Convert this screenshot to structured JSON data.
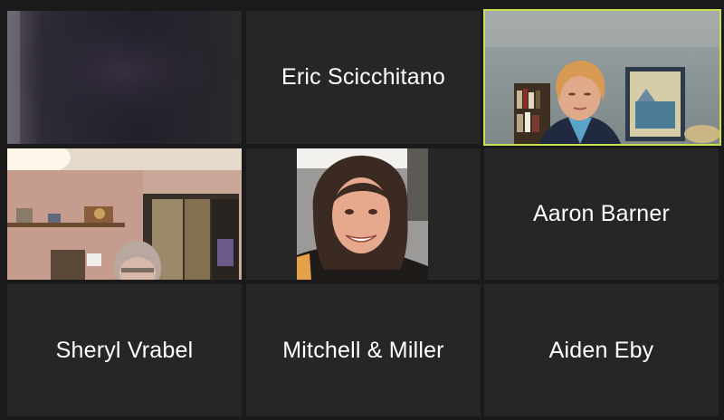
{
  "app": {
    "type": "video-call-gallery-view"
  },
  "colors": {
    "tile_bg": "#262626",
    "gap_bg": "#1a1a1a",
    "active_speaker_border": "#c8e04f",
    "name_text": "#ffffff"
  },
  "participants": [
    {
      "name": "",
      "video": "dark-blurry-camera"
    },
    {
      "name": "Eric Scicchitano",
      "video": "off"
    },
    {
      "name": "",
      "video": "on",
      "active_speaker": true
    },
    {
      "name": "",
      "video": "on"
    },
    {
      "name": "",
      "video": "on"
    },
    {
      "name": "Aaron Barner",
      "video": "off"
    },
    {
      "name": "Sheryl Vrabel",
      "video": "off"
    },
    {
      "name": "Mitchell & Miller",
      "video": "off"
    },
    {
      "name": "Aiden Eby",
      "video": "off"
    }
  ]
}
